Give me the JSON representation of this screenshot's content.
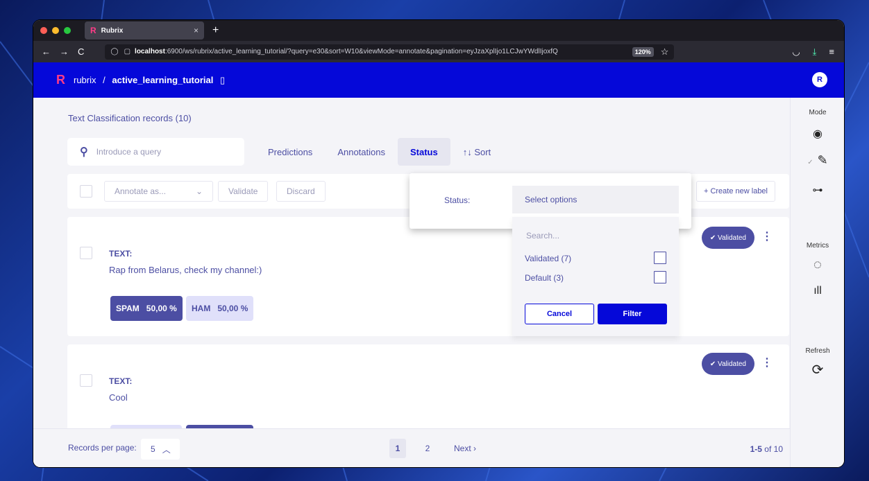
{
  "browser": {
    "tab_title": "Rubrix",
    "tab_logo": "R",
    "url_host": "localhost",
    "url_rest": ":6900/ws/rubrix/active_learning_tutorial/?query=e30&sort=W10&viewMode=annotate&pagination=eyJzaXplIjo1LCJwYWdlIjoxfQ",
    "zoom": "120%"
  },
  "header": {
    "workspace": "rubrix",
    "separator": "/",
    "dataset": "active_learning_tutorial",
    "avatar": "R"
  },
  "main": {
    "title": "Text Classification records (10)",
    "search_placeholder": "Introduce a query",
    "filters": [
      "Predictions",
      "Annotations",
      "Status",
      "↑↓ Sort"
    ],
    "bulk": {
      "annotate_as": "Annotate as...",
      "validate": "Validate",
      "discard": "Discard",
      "create_label": "+ Create new label"
    },
    "records": [
      {
        "label": "TEXT:",
        "text": "Rap from Belarus, check my channel:)",
        "status": "✔ Validated",
        "chips": [
          {
            "name": "SPAM",
            "score": "50,00 %"
          },
          {
            "name": "HAM",
            "score": "50,00 %"
          }
        ]
      },
      {
        "label": "TEXT:",
        "text": "Cool",
        "status": "✔ Validated"
      }
    ]
  },
  "status_popup": {
    "label": "Status:",
    "select_placeholder": "Select options",
    "search_placeholder": "Search...",
    "options": [
      {
        "label": "Validated (7)"
      },
      {
        "label": "Default (3)"
      }
    ],
    "cancel": "Cancel",
    "filter": "Filter"
  },
  "footer": {
    "records_per_page_label": "Records per page:",
    "records_per_page": "5",
    "pages": [
      "1",
      "2"
    ],
    "next": "Next ›",
    "range": "1-5",
    "of": "of 10"
  },
  "sidebar": {
    "mode": "Mode",
    "metrics": "Metrics",
    "refresh": "Refresh"
  },
  "colors": {
    "brand_blue": "#0508d9",
    "text_purple": "#4c4ea3",
    "logo_pink": "#ff3b87"
  }
}
